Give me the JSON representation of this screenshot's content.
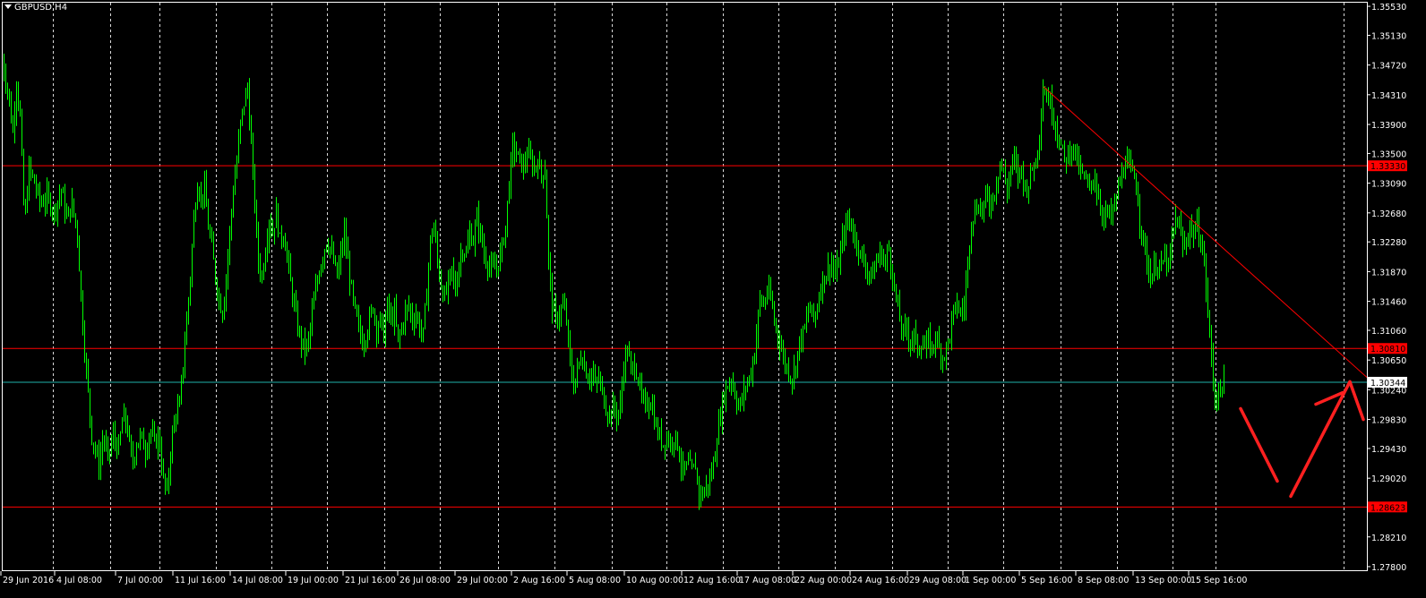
{
  "window": {
    "symbol_label": "GBPUSD,H4"
  },
  "colors": {
    "background": "#000000",
    "candle": "#00ff00",
    "grid": "#ffffff",
    "axis_text": "#ffffff",
    "level_line": "#ff0000",
    "trendline": "#ff0000",
    "bid_line": "#20b2aa",
    "drawing": "#ff2020"
  },
  "price_axis": {
    "ticks": [
      "1.35530",
      "1.35130",
      "1.34720",
      "1.34310",
      "1.33900",
      "1.33500",
      "1.33090",
      "1.32680",
      "1.32280",
      "1.31870",
      "1.31460",
      "1.31060",
      "1.30650",
      "1.30240",
      "1.29830",
      "1.29430",
      "1.29020",
      "1.28620",
      "1.28210",
      "1.27800"
    ],
    "range": [
      1.2775,
      1.3558
    ]
  },
  "time_axis": {
    "ticks": [
      "29 Jun 2016",
      "4 Jul 08:00",
      "7 Jul 00:00",
      "11 Jul 16:00",
      "14 Jul 08:00",
      "19 Jul 00:00",
      "21 Jul 16:00",
      "26 Jul 08:00",
      "29 Jul 00:00",
      "2 Aug 16:00",
      "5 Aug 08:00",
      "10 Aug 00:00",
      "12 Aug 16:00",
      "17 Aug 08:00",
      "22 Aug 00:00",
      "24 Aug 16:00",
      "29 Aug 08:00",
      "1 Sep 00:00",
      "5 Sep 16:00",
      "8 Sep 08:00",
      "13 Sep 00:00",
      "15 Sep 16:00"
    ]
  },
  "levels": [
    {
      "price": 1.3333,
      "label": "1.33330",
      "style": "red"
    },
    {
      "price": 1.3081,
      "label": "1.30810",
      "style": "red"
    },
    {
      "price": 1.28623,
      "label": "1.28623",
      "style": "red"
    }
  ],
  "bid": {
    "price": 1.30344,
    "label": "1.30344"
  },
  "price_path": [
    [
      0,
      1.35
    ],
    [
      3,
      1.347
    ],
    [
      8,
      1.344
    ],
    [
      14,
      1.338
    ],
    [
      18,
      1.345
    ],
    [
      22,
      1.34
    ],
    [
      27,
      1.325
    ],
    [
      32,
      1.333
    ],
    [
      38,
      1.331
    ],
    [
      45,
      1.328
    ],
    [
      52,
      1.329
    ],
    [
      60,
      1.327
    ],
    [
      68,
      1.33
    ],
    [
      74,
      1.326
    ],
    [
      80,
      1.328
    ],
    [
      86,
      1.324
    ],
    [
      90,
      1.315
    ],
    [
      94,
      1.308
    ],
    [
      98,
      1.302
    ],
    [
      102,
      1.296
    ],
    [
      106,
      1.294
    ],
    [
      110,
      1.292
    ],
    [
      115,
      1.296
    ],
    [
      120,
      1.293
    ],
    [
      126,
      1.296
    ],
    [
      132,
      1.294
    ],
    [
      137,
      1.299
    ],
    [
      142,
      1.297
    ],
    [
      147,
      1.292
    ],
    [
      152,
      1.295
    ],
    [
      157,
      1.296
    ],
    [
      162,
      1.294
    ],
    [
      167,
      1.297
    ],
    [
      172,
      1.295
    ],
    [
      177,
      1.296
    ],
    [
      182,
      1.29
    ],
    [
      186,
      1.288
    ],
    [
      190,
      1.294
    ],
    [
      195,
      1.299
    ],
    [
      200,
      1.3
    ],
    [
      204,
      1.306
    ],
    [
      208,
      1.312
    ],
    [
      212,
      1.318
    ],
    [
      216,
      1.326
    ],
    [
      220,
      1.331
    ],
    [
      224,
      1.329
    ],
    [
      228,
      1.33
    ],
    [
      232,
      1.325
    ],
    [
      236,
      1.322
    ],
    [
      240,
      1.318
    ],
    [
      244,
      1.315
    ],
    [
      248,
      1.313
    ],
    [
      252,
      1.318
    ],
    [
      256,
      1.324
    ],
    [
      260,
      1.33
    ],
    [
      264,
      1.334
    ],
    [
      268,
      1.339
    ],
    [
      272,
      1.342
    ],
    [
      276,
      1.344
    ],
    [
      280,
      1.336
    ],
    [
      284,
      1.328
    ],
    [
      288,
      1.32
    ],
    [
      292,
      1.318
    ],
    [
      296,
      1.322
    ],
    [
      300,
      1.326
    ],
    [
      304,
      1.324
    ],
    [
      308,
      1.327
    ],
    [
      312,
      1.323
    ],
    [
      316,
      1.324
    ],
    [
      320,
      1.321
    ],
    [
      324,
      1.317
    ],
    [
      328,
      1.314
    ],
    [
      332,
      1.311
    ],
    [
      336,
      1.309
    ],
    [
      340,
      1.308
    ],
    [
      344,
      1.309
    ],
    [
      348,
      1.313
    ],
    [
      352,
      1.316
    ],
    [
      356,
      1.319
    ],
    [
      360,
      1.321
    ],
    [
      364,
      1.323
    ],
    [
      368,
      1.322
    ],
    [
      372,
      1.32
    ],
    [
      376,
      1.318
    ],
    [
      380,
      1.321
    ],
    [
      384,
      1.324
    ],
    [
      388,
      1.32
    ],
    [
      392,
      1.316
    ],
    [
      396,
      1.313
    ],
    [
      400,
      1.311
    ],
    [
      404,
      1.309
    ],
    [
      408,
      1.31
    ],
    [
      412,
      1.312
    ],
    [
      416,
      1.314
    ],
    [
      420,
      1.311
    ],
    [
      424,
      1.312
    ],
    [
      428,
      1.31
    ],
    [
      432,
      1.314
    ],
    [
      436,
      1.312
    ],
    [
      440,
      1.313
    ],
    [
      444,
      1.309
    ],
    [
      448,
      1.311
    ],
    [
      452,
      1.313
    ],
    [
      456,
      1.314
    ],
    [
      460,
      1.312
    ],
    [
      464,
      1.313
    ],
    [
      468,
      1.311
    ],
    [
      472,
      1.31
    ],
    [
      476,
      1.316
    ],
    [
      480,
      1.323
    ],
    [
      484,
      1.325
    ],
    [
      488,
      1.32
    ],
    [
      492,
      1.317
    ],
    [
      496,
      1.315
    ],
    [
      500,
      1.317
    ],
    [
      504,
      1.319
    ],
    [
      508,
      1.316
    ],
    [
      512,
      1.32
    ],
    [
      516,
      1.322
    ],
    [
      520,
      1.321
    ],
    [
      524,
      1.324
    ],
    [
      528,
      1.323
    ],
    [
      532,
      1.326
    ],
    [
      536,
      1.324
    ],
    [
      540,
      1.321
    ],
    [
      544,
      1.32
    ],
    [
      548,
      1.319
    ],
    [
      552,
      1.319
    ],
    [
      556,
      1.32
    ],
    [
      560,
      1.322
    ],
    [
      564,
      1.325
    ],
    [
      568,
      1.331
    ],
    [
      572,
      1.336
    ],
    [
      576,
      1.335
    ],
    [
      580,
      1.334
    ],
    [
      584,
      1.333
    ],
    [
      588,
      1.335
    ],
    [
      592,
      1.334
    ],
    [
      596,
      1.333
    ],
    [
      600,
      1.334
    ],
    [
      604,
      1.332
    ],
    [
      608,
      1.333
    ],
    [
      612,
      1.32
    ],
    [
      616,
      1.314
    ],
    [
      620,
      1.312
    ],
    [
      624,
      1.313
    ],
    [
      628,
      1.314
    ],
    [
      632,
      1.312
    ],
    [
      636,
      1.306
    ],
    [
      640,
      1.303
    ],
    [
      644,
      1.305
    ],
    [
      648,
      1.307
    ],
    [
      652,
      1.306
    ],
    [
      656,
      1.304
    ],
    [
      660,
      1.305
    ],
    [
      664,
      1.303
    ],
    [
      668,
      1.304
    ],
    [
      672,
      1.302
    ],
    [
      676,
      1.3
    ],
    [
      680,
      1.299
    ],
    [
      684,
      1.3
    ],
    [
      688,
      1.299
    ],
    [
      692,
      1.3
    ],
    [
      696,
      1.306
    ],
    [
      700,
      1.308
    ],
    [
      704,
      1.305
    ],
    [
      708,
      1.306
    ],
    [
      712,
      1.304
    ],
    [
      716,
      1.301
    ],
    [
      720,
      1.3
    ],
    [
      724,
      1.301
    ],
    [
      728,
      1.3
    ],
    [
      732,
      1.297
    ],
    [
      736,
      1.296
    ],
    [
      740,
      1.295
    ],
    [
      744,
      1.296
    ],
    [
      748,
      1.295
    ],
    [
      752,
      1.296
    ],
    [
      756,
      1.295
    ],
    [
      760,
      1.292
    ],
    [
      764,
      1.291
    ],
    [
      768,
      1.292
    ],
    [
      772,
      1.291
    ],
    [
      776,
      1.292
    ],
    [
      780,
      1.288
    ],
    [
      784,
      1.288
    ],
    [
      788,
      1.289
    ],
    [
      792,
      1.29
    ],
    [
      796,
      1.292
    ],
    [
      800,
      1.296
    ],
    [
      804,
      1.299
    ],
    [
      808,
      1.302
    ],
    [
      812,
      1.303
    ],
    [
      816,
      1.304
    ],
    [
      820,
      1.302
    ],
    [
      824,
      1.3
    ],
    [
      828,
      1.301
    ],
    [
      832,
      1.303
    ],
    [
      836,
      1.304
    ],
    [
      840,
      1.306
    ],
    [
      844,
      1.31
    ],
    [
      848,
      1.315
    ],
    [
      852,
      1.314
    ],
    [
      856,
      1.316
    ],
    [
      860,
      1.315
    ],
    [
      864,
      1.312
    ],
    [
      868,
      1.31
    ],
    [
      872,
      1.308
    ],
    [
      876,
      1.306
    ],
    [
      880,
      1.305
    ],
    [
      884,
      1.304
    ],
    [
      888,
      1.306
    ],
    [
      892,
      1.309
    ],
    [
      896,
      1.31
    ],
    [
      900,
      1.312
    ],
    [
      904,
      1.314
    ],
    [
      908,
      1.312
    ],
    [
      912,
      1.314
    ],
    [
      916,
      1.317
    ],
    [
      920,
      1.318
    ],
    [
      924,
      1.319
    ],
    [
      928,
      1.32
    ],
    [
      932,
      1.318
    ],
    [
      936,
      1.32
    ],
    [
      940,
      1.323
    ],
    [
      944,
      1.325
    ],
    [
      948,
      1.326
    ],
    [
      952,
      1.324
    ],
    [
      956,
      1.323
    ],
    [
      960,
      1.321
    ],
    [
      964,
      1.32
    ],
    [
      968,
      1.319
    ],
    [
      972,
      1.318
    ],
    [
      976,
      1.319
    ],
    [
      980,
      1.321
    ],
    [
      984,
      1.321
    ],
    [
      988,
      1.32
    ],
    [
      992,
      1.322
    ],
    [
      996,
      1.318
    ],
    [
      1000,
      1.315
    ],
    [
      1004,
      1.312
    ],
    [
      1008,
      1.31
    ],
    [
      1012,
      1.311
    ],
    [
      1016,
      1.309
    ],
    [
      1020,
      1.31
    ],
    [
      1024,
      1.308
    ],
    [
      1028,
      1.309
    ],
    [
      1032,
      1.308
    ],
    [
      1036,
      1.309
    ],
    [
      1040,
      1.308
    ],
    [
      1044,
      1.31
    ],
    [
      1048,
      1.308
    ],
    [
      1052,
      1.307
    ],
    [
      1056,
      1.308
    ],
    [
      1060,
      1.31
    ],
    [
      1064,
      1.313
    ],
    [
      1068,
      1.314
    ],
    [
      1072,
      1.313
    ],
    [
      1076,
      1.314
    ],
    [
      1080,
      1.32
    ],
    [
      1084,
      1.326
    ],
    [
      1088,
      1.327
    ],
    [
      1092,
      1.328
    ],
    [
      1096,
      1.327
    ],
    [
      1100,
      1.329
    ],
    [
      1104,
      1.328
    ],
    [
      1108,
      1.329
    ],
    [
      1112,
      1.331
    ],
    [
      1116,
      1.334
    ],
    [
      1120,
      1.332
    ],
    [
      1124,
      1.33
    ],
    [
      1128,
      1.333
    ],
    [
      1132,
      1.334
    ],
    [
      1136,
      1.332
    ],
    [
      1140,
      1.333
    ],
    [
      1144,
      1.33
    ],
    [
      1148,
      1.331
    ],
    [
      1152,
      1.333
    ],
    [
      1156,
      1.334
    ],
    [
      1160,
      1.338
    ],
    [
      1164,
      1.344
    ],
    [
      1168,
      1.343
    ],
    [
      1172,
      1.342
    ],
    [
      1176,
      1.34
    ],
    [
      1180,
      1.338
    ],
    [
      1184,
      1.336
    ],
    [
      1188,
      1.334
    ],
    [
      1192,
      1.335
    ],
    [
      1196,
      1.336
    ],
    [
      1200,
      1.335
    ],
    [
      1204,
      1.333
    ],
    [
      1208,
      1.332
    ],
    [
      1212,
      1.331
    ],
    [
      1216,
      1.33
    ],
    [
      1220,
      1.332
    ],
    [
      1224,
      1.33
    ],
    [
      1228,
      1.328
    ],
    [
      1232,
      1.326
    ],
    [
      1236,
      1.327
    ],
    [
      1240,
      1.326
    ],
    [
      1244,
      1.328
    ],
    [
      1248,
      1.33
    ],
    [
      1252,
      1.332
    ],
    [
      1256,
      1.334
    ],
    [
      1260,
      1.333
    ],
    [
      1264,
      1.332
    ],
    [
      1268,
      1.331
    ],
    [
      1272,
      1.326
    ],
    [
      1276,
      1.323
    ],
    [
      1280,
      1.32
    ],
    [
      1284,
      1.318
    ],
    [
      1288,
      1.319
    ],
    [
      1292,
      1.32
    ],
    [
      1296,
      1.319
    ],
    [
      1300,
      1.321
    ],
    [
      1304,
      1.319
    ],
    [
      1308,
      1.323
    ],
    [
      1312,
      1.326
    ],
    [
      1316,
      1.325
    ],
    [
      1320,
      1.322
    ],
    [
      1324,
      1.323
    ],
    [
      1328,
      1.325
    ],
    [
      1332,
      1.324
    ],
    [
      1336,
      1.325
    ],
    [
      1340,
      1.323
    ],
    [
      1344,
      1.32
    ],
    [
      1348,
      1.313
    ],
    [
      1352,
      1.307
    ],
    [
      1356,
      1.301
    ],
    [
      1360,
      1.302
    ],
    [
      1364,
      1.303
    ],
    [
      1366,
      1.3034
    ]
  ],
  "trendline": {
    "from": [
      1165,
      1.3442
    ],
    "to": [
      1527,
      1.304
    ]
  },
  "drawings": [
    {
      "from": [
        1385,
        1.2998
      ],
      "to": [
        1426,
        1.2898
      ]
    },
    {
      "from": [
        1441,
        1.2877
      ],
      "to": [
        1507,
        1.3035
      ]
    },
    {
      "from": [
        1469,
        1.3004
      ],
      "to": [
        1499,
        1.302
      ]
    },
    {
      "from": [
        1507,
        1.3035
      ],
      "to": [
        1522,
        1.2983
      ]
    }
  ]
}
